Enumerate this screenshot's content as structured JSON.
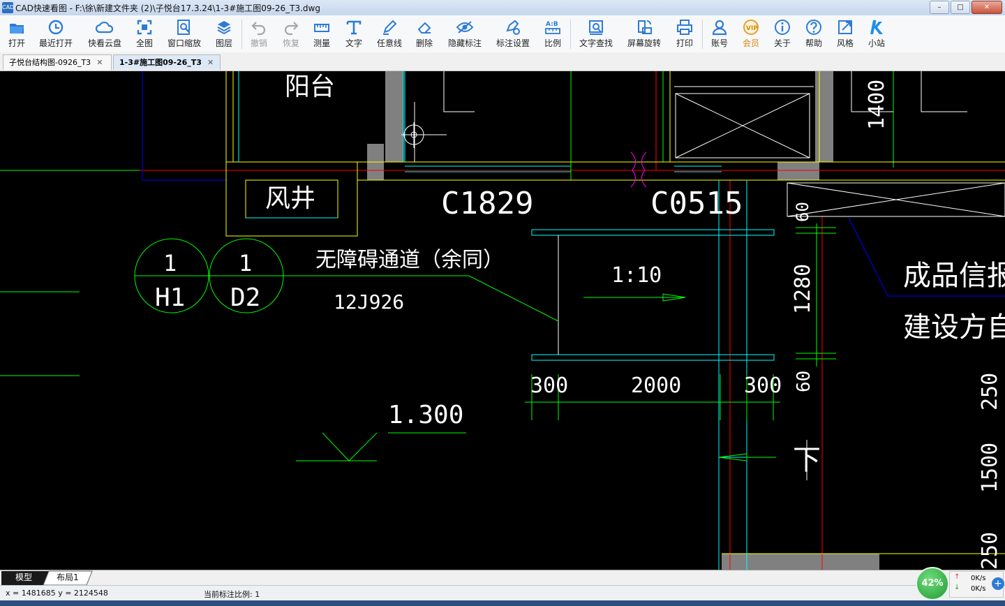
{
  "window": {
    "title": "CAD快速看图 - F:\\徐\\新建文件夹 (2)\\子悦台17.3.24\\1-3#施工图09-26_T3.dwg",
    "app_icon_text": "CAD",
    "minimize": "–",
    "maximize": "□",
    "close": "✕"
  },
  "toolbar": {
    "items": [
      {
        "label": "打开",
        "icon": "folder-open-icon"
      },
      {
        "label": "最近打开",
        "icon": "clock-history-icon"
      },
      {
        "label": "快看云盘",
        "icon": "cloud-icon"
      },
      {
        "label": "全图",
        "icon": "fit-all-icon"
      },
      {
        "label": "窗口缩放",
        "icon": "zoom-window-icon"
      },
      {
        "label": "图层",
        "icon": "layers-icon"
      },
      {
        "label": "撤销",
        "icon": "undo-icon"
      },
      {
        "label": "恢复",
        "icon": "redo-icon"
      },
      {
        "label": "测量",
        "icon": "ruler-icon"
      },
      {
        "label": "文字",
        "icon": "text-icon"
      },
      {
        "label": "任意线",
        "icon": "pen-icon"
      },
      {
        "label": "删除",
        "icon": "eraser-icon"
      },
      {
        "label": "隐藏标注",
        "icon": "eye-hide-icon"
      },
      {
        "label": "标注设置",
        "icon": "annotation-settings-icon"
      },
      {
        "label": "比例",
        "icon": "scale-icon"
      },
      {
        "label": "文字查找",
        "icon": "text-search-icon"
      },
      {
        "label": "屏幕旋转",
        "icon": "rotate-screen-icon"
      },
      {
        "label": "打印",
        "icon": "printer-icon"
      },
      {
        "label": "账号",
        "icon": "user-icon"
      },
      {
        "label": "会员",
        "icon": "vip-icon"
      },
      {
        "label": "关于",
        "icon": "info-icon"
      },
      {
        "label": "帮助",
        "icon": "help-icon"
      },
      {
        "label": "风格",
        "icon": "style-icon"
      },
      {
        "label": "小站",
        "icon": "k-site-icon"
      }
    ]
  },
  "tabs": [
    {
      "label": "子悦台结构图-0926_T3",
      "close": "✕"
    },
    {
      "label": "1-3#施工图09-26_T3",
      "close": "✕"
    }
  ],
  "drawing": {
    "texts": {
      "balcony": "阳台",
      "shaft": "风井",
      "window_c1829": "C1829",
      "window_c0515": "C0515",
      "accessible_path": "无障碍通道（余同）",
      "std_ref": "12J926",
      "slope": "1:10",
      "detail_num1": "1",
      "detail_sheet1": "H1",
      "detail_num2": "1",
      "detail_sheet2": "D2",
      "elevation": "1.300",
      "dim_1400": "1400",
      "dim_60_top": "60",
      "dim_1280": "1280",
      "dim_60_bottom": "60",
      "dim_300_left": "300",
      "dim_2000": "2000",
      "dim_300_right": "300",
      "dim_250_top": "250",
      "dim_1500": "1500",
      "dim_250_bottom": "250",
      "down": "下",
      "note_line1": "成品信报",
      "note_line2": "建设方自"
    },
    "colors": {
      "white": "#ffffff",
      "yellow": "#ffff00",
      "cyan": "#00ffff",
      "green": "#00ff00",
      "red": "#ff0000",
      "blue": "#0000ff",
      "magenta": "#ff00ff",
      "gray": "#808080"
    }
  },
  "layout_tabs": {
    "model": "模型",
    "layout1": "布局1"
  },
  "status": {
    "coords": "x = 1481685  y = 2124548",
    "scale": "当前标注比例: 1"
  },
  "netmon": {
    "percent": "42%",
    "up": "0K/s",
    "down": "0K/s"
  }
}
